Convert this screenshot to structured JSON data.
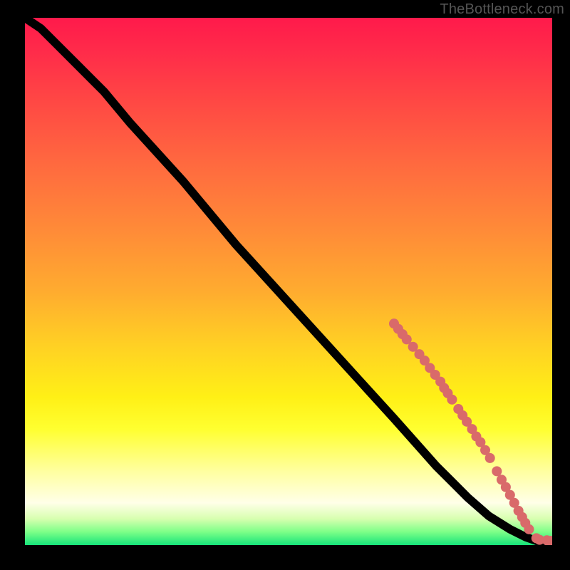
{
  "watermark": "TheBottleneck.com",
  "colors": {
    "dot": "#d96a6a",
    "curve": "#000000",
    "frame": "#000000"
  },
  "chart_data": {
    "type": "line",
    "title": "",
    "xlabel": "",
    "ylabel": "",
    "xlim": [
      0,
      100
    ],
    "ylim": [
      0,
      100
    ],
    "grid": false,
    "legend": false,
    "series": [
      {
        "name": "curve",
        "x": [
          0,
          3,
          6,
          10,
          15,
          20,
          30,
          40,
          50,
          60,
          70,
          78,
          84,
          88,
          92,
          95,
          97,
          98.5,
          100
        ],
        "y": [
          100,
          98,
          95,
          91,
          86,
          80,
          69,
          57,
          46,
          35,
          24,
          15,
          9,
          5.5,
          3.0,
          1.5,
          0.8,
          0.3,
          0.2
        ]
      }
    ],
    "points": [
      {
        "x": 70.0,
        "y": 42.0
      },
      {
        "x": 70.8,
        "y": 41.0
      },
      {
        "x": 71.6,
        "y": 40.0
      },
      {
        "x": 72.4,
        "y": 39.0
      },
      {
        "x": 73.6,
        "y": 37.6
      },
      {
        "x": 74.8,
        "y": 36.2
      },
      {
        "x": 75.8,
        "y": 35.0
      },
      {
        "x": 76.8,
        "y": 33.6
      },
      {
        "x": 77.8,
        "y": 32.3
      },
      {
        "x": 78.8,
        "y": 31.0
      },
      {
        "x": 79.5,
        "y": 29.8
      },
      {
        "x": 80.2,
        "y": 28.8
      },
      {
        "x": 81.0,
        "y": 27.6
      },
      {
        "x": 82.2,
        "y": 25.8
      },
      {
        "x": 83.0,
        "y": 24.6
      },
      {
        "x": 83.8,
        "y": 23.4
      },
      {
        "x": 84.8,
        "y": 22.0
      },
      {
        "x": 85.6,
        "y": 20.6
      },
      {
        "x": 86.4,
        "y": 19.5
      },
      {
        "x": 87.3,
        "y": 18.0
      },
      {
        "x": 88.2,
        "y": 16.5
      },
      {
        "x": 89.5,
        "y": 14.0
      },
      {
        "x": 90.4,
        "y": 12.4
      },
      {
        "x": 91.2,
        "y": 11.0
      },
      {
        "x": 92.0,
        "y": 9.5
      },
      {
        "x": 92.8,
        "y": 8.0
      },
      {
        "x": 93.6,
        "y": 6.5
      },
      {
        "x": 94.3,
        "y": 5.3
      },
      {
        "x": 94.9,
        "y": 4.2
      },
      {
        "x": 95.6,
        "y": 3.0
      },
      {
        "x": 97.0,
        "y": 1.3
      },
      {
        "x": 97.6,
        "y": 1.0
      },
      {
        "x": 99.0,
        "y": 0.9
      },
      {
        "x": 99.8,
        "y": 0.8
      }
    ]
  }
}
